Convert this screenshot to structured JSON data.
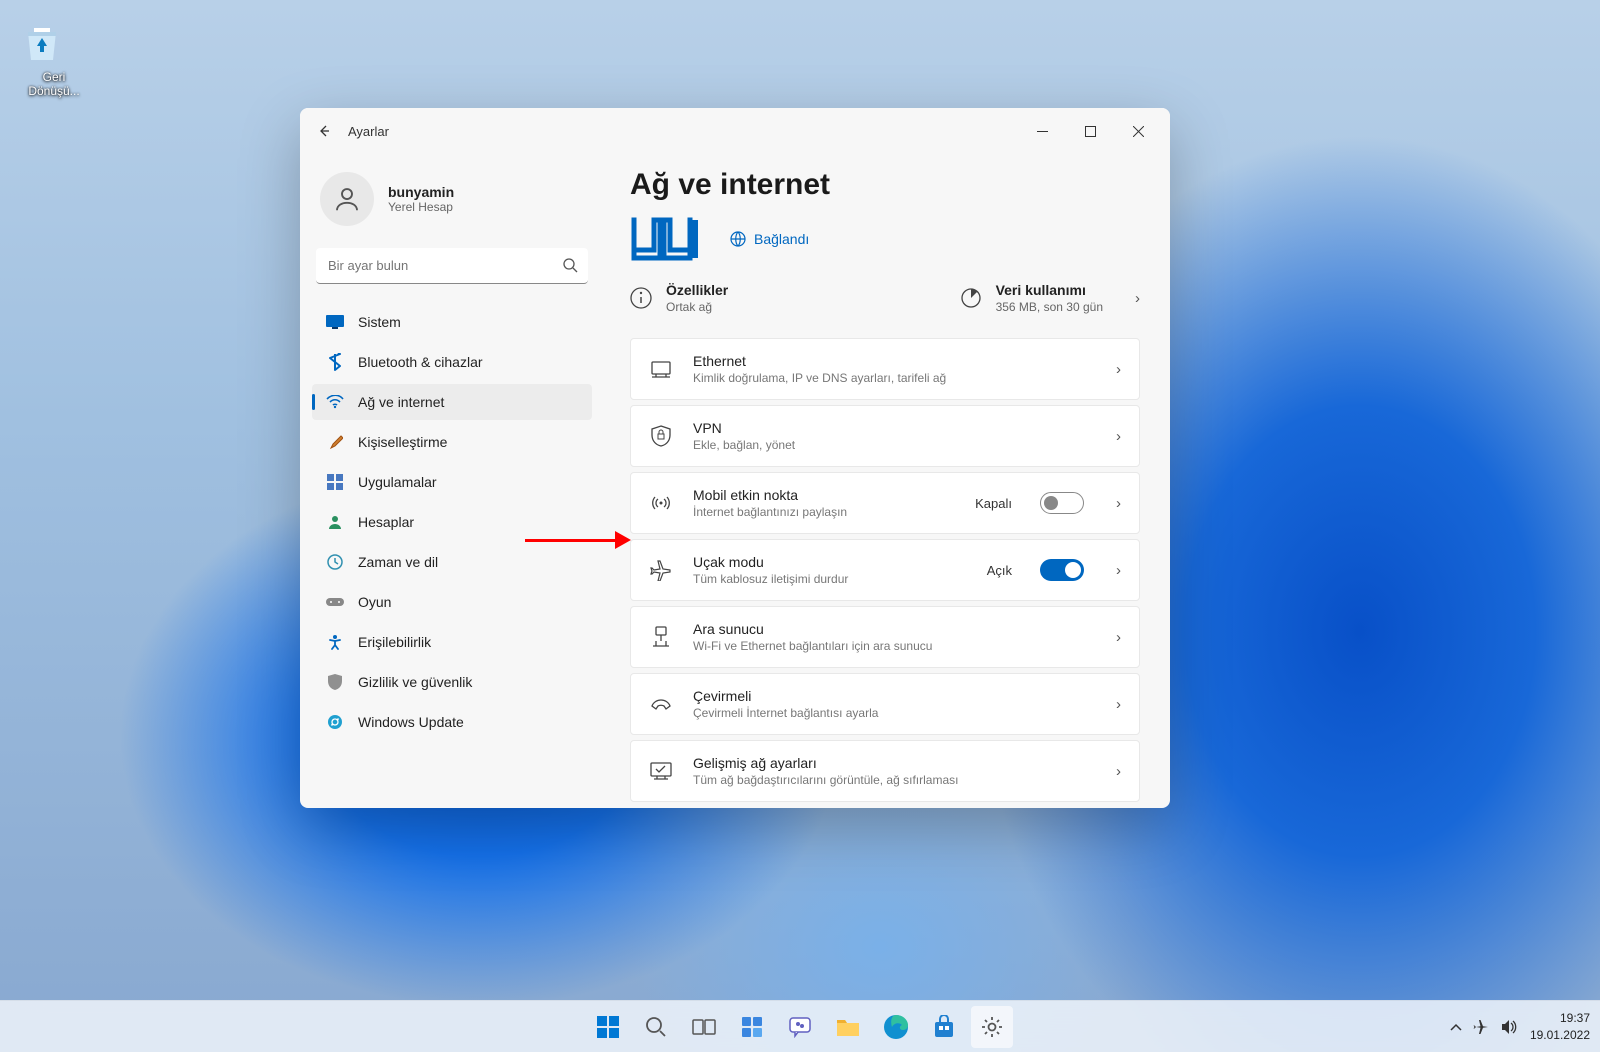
{
  "desktop": {
    "recycle_bin": "Geri Dönüşü..."
  },
  "window": {
    "title": "Ayarlar",
    "user": {
      "name": "bunyamin",
      "subtitle": "Yerel Hesap"
    },
    "search_placeholder": "Bir ayar bulun",
    "nav": {
      "system": "Sistem",
      "bluetooth": "Bluetooth & cihazlar",
      "network": "Ağ ve internet",
      "personalization": "Kişiselleştirme",
      "apps": "Uygulamalar",
      "accounts": "Hesaplar",
      "time": "Zaman ve dil",
      "gaming": "Oyun",
      "accessibility": "Erişilebilirlik",
      "privacy": "Gizlilik ve güvenlik",
      "update": "Windows Update"
    },
    "page": {
      "title": "Ağ ve internet",
      "connected": "Bağlandı",
      "properties": {
        "title": "Özellikler",
        "sub": "Ortak ağ"
      },
      "data_usage": {
        "title": "Veri kullanımı",
        "sub": "356 MB, son 30 gün"
      },
      "cards": {
        "ethernet": {
          "t": "Ethernet",
          "s": "Kimlik doğrulama, IP ve DNS ayarları, tarifeli ağ"
        },
        "vpn": {
          "t": "VPN",
          "s": "Ekle, bağlan, yönet"
        },
        "hotspot": {
          "t": "Mobil etkin nokta",
          "s": "İnternet bağlantınızı paylaşın",
          "state": "Kapalı"
        },
        "airplane": {
          "t": "Uçak modu",
          "s": "Tüm kablosuz iletişimi durdur",
          "state": "Açık"
        },
        "proxy": {
          "t": "Ara sunucu",
          "s": "Wi-Fi ve Ethernet bağlantıları için ara sunucu"
        },
        "dialup": {
          "t": "Çevirmeli",
          "s": "Çevirmeli İnternet bağlantısı ayarla"
        },
        "advanced": {
          "t": "Gelişmiş ağ ayarları",
          "s": "Tüm ağ bağdaştırıcılarını görüntüle, ağ sıfırlaması"
        }
      }
    }
  },
  "taskbar": {
    "time": "19:37",
    "date": "19.01.2022"
  }
}
